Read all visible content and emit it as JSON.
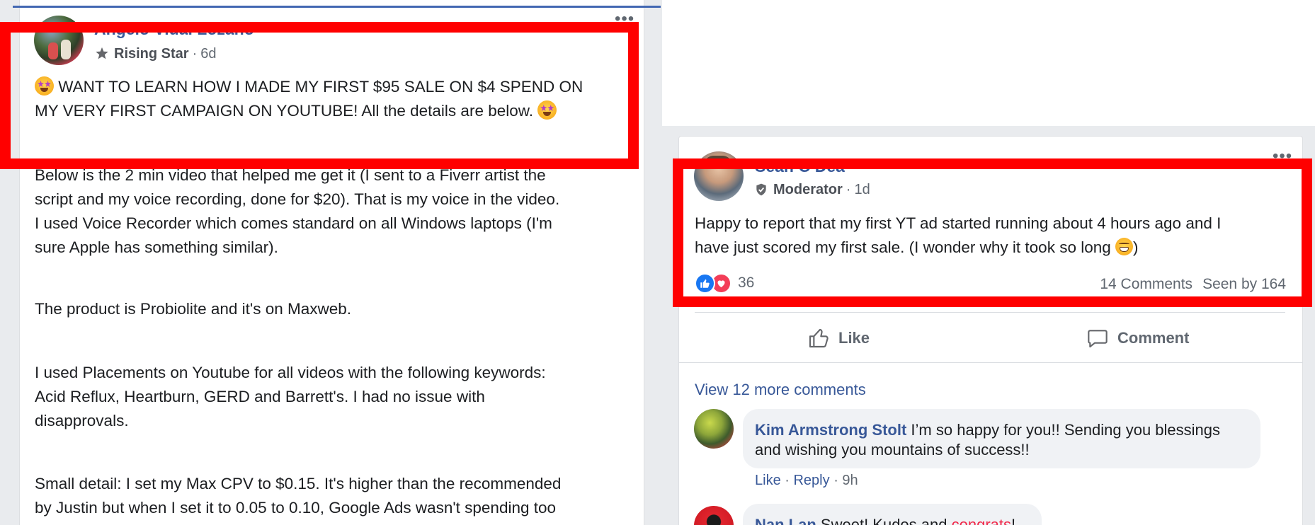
{
  "left_post": {
    "author": "Angelo Vidal Lozano",
    "badge": "Rising Star",
    "time": "6d",
    "headline_line1": "WANT TO LEARN HOW I MADE MY FIRST $95 SALE ON $4 SPEND ON",
    "headline_line2": "MY VERY FIRST CAMPAIGN ON YOUTUBE! All the details are below.",
    "para1_line1": "Below is the 2 min video that helped me get it (I sent to a Fiverr artist the",
    "para1_line2": "script and my voice recording, done for $20). That is my voice in the video.",
    "para1_line3": "I used Voice Recorder which comes standard on all Windows laptops (I'm",
    "para1_line4": "sure Apple has something similar).",
    "para2": "The product is Probiolite and it's on Maxweb.",
    "para3_line1": "I used Placements on Youtube for all videos with the following keywords:",
    "para3_line2": "Acid Reflux, Heartburn, GERD and Barrett's. I had no issue with",
    "para3_line3": "disapprovals.",
    "para4_line1": "Small detail: I set my Max CPV to $0.15. It's higher than the recommended",
    "para4_line2": "by Justin but when I set it to 0.05 to 0.10, Google Ads wasn't spending too"
  },
  "right_post": {
    "author": "Sean O'Dea",
    "badge": "Moderator",
    "time": "1d",
    "text_line1": "Happy to report that my first YT ad started running about 4 hours ago and I",
    "text_line2": "have just scored my first sale. (I wonder why it took so long",
    "text_line2_end": ")",
    "reaction_count": "36",
    "comments_count": "14 Comments",
    "seen_by": "Seen by 164",
    "like_label": "Like",
    "comment_label": "Comment",
    "view_more": "View 12 more comments"
  },
  "comments": [
    {
      "author": "Kim Armstrong Stolt",
      "text_line1": "I’m so happy for you!! Sending you blessings",
      "text_line2": "and wishing you mountains of success!!",
      "like": "Like",
      "reply": "Reply",
      "time": "9h"
    },
    {
      "author": "Nan Lan",
      "text_a": "Sweet! Kudos and ",
      "hashtag": "congrats",
      "text_b": "!"
    }
  ],
  "colors": {
    "highlight": "#ff0000",
    "link": "#385898",
    "like_blue": "#1877f2",
    "love_red": "#f33e58"
  }
}
